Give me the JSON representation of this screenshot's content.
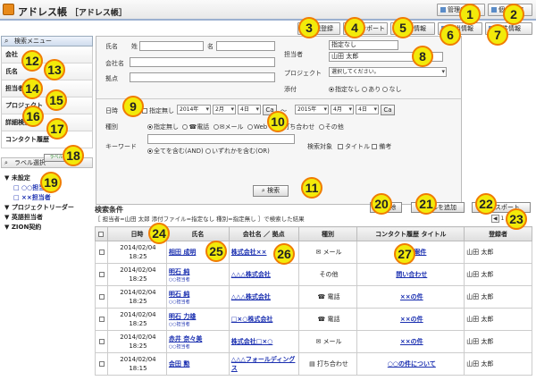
{
  "app": {
    "title": "アドレス帳",
    "subtitle": "［アドレス帳］"
  },
  "toolbar": {
    "manager_settings": "管理者設定",
    "personal_settings": "個人設定",
    "register": "新規登録",
    "import": "インポート",
    "company_info": "会社情報",
    "group_info": "担当情報",
    "project_info": "案件情報"
  },
  "sidebar": {
    "header": "検索メニュー",
    "items": [
      "会社",
      "氏名",
      "担当者",
      "プロジェクト",
      "詳細検索",
      "コンタクト履歴"
    ],
    "label_select": "ラベル選択",
    "label_btn": "ラベル",
    "tree": [
      {
        "label": "▼ 未設定",
        "indent": 0
      },
      {
        "label": "□ ○○担当者",
        "indent": 1
      },
      {
        "label": "□ ××担当者",
        "indent": 1
      },
      {
        "label": "▼ プロジェクトリーダー",
        "indent": 0
      },
      {
        "label": "▼ 英語担当者",
        "indent": 0
      },
      {
        "label": "▼ ZION契約",
        "indent": 0
      }
    ]
  },
  "form": {
    "name_label": "氏名",
    "sei_label": "姓",
    "mei_label": "名",
    "company_label": "会社名",
    "base_label": "拠点",
    "tantou_label": "担当者",
    "tantou_value1": "指定なし",
    "tantou_value2": "山田 太郎",
    "project_label": "プロジェクト",
    "project_value": "選択してください。",
    "attach_label": "添付",
    "attach_opts": [
      "指定なし",
      "あり",
      "なし"
    ],
    "date_label": "日時",
    "date_nospec": "指定無し",
    "from_year": "2014年",
    "from_month": "2月",
    "from_day": "4日",
    "cal": "Ca",
    "to_year": "2015年",
    "to_month": "4月",
    "to_day": "4日",
    "tilde": "～",
    "type_label": "種別",
    "type_opts": [
      "指定無し",
      "電話",
      "メール",
      "Web",
      "打ち合わせ",
      "その他"
    ],
    "keyword_label": "キーワード",
    "kw_opts": [
      "全てを含む(AND)",
      "いずれかを含む(OR)"
    ],
    "target_label": "検索対象",
    "target_opts": [
      "タイトル",
      "備考"
    ],
    "search_btn": "検索"
  },
  "results": {
    "heading": "検索条件",
    "condition": "［ 担当者=山田 太郎 添付ファイル=指定なし 種別=指定無し ］で検索した結果",
    "delete_btn": "削除",
    "add_label_btn": "ラベルを追加",
    "export_btn": "エクスポート",
    "pager": "1 / 2",
    "columns": [
      "",
      "日時",
      "氏名",
      "会社名 ／ 拠点",
      "種別",
      "コンタクト履歴 タイトル",
      "登録者"
    ],
    "rows": [
      {
        "date": "2014/02/04",
        "time": "18:25",
        "name": "相田 成明",
        "sub": "",
        "company": "株式会社××",
        "type": "メール",
        "title": "○○の案件",
        "user": "山田 太郎"
      },
      {
        "date": "2014/02/04",
        "time": "18:25",
        "name": "明石 純",
        "sub": "○○担当者",
        "company": "△△△株式会社",
        "type": "その他",
        "title": "問い合わせ",
        "user": "山田 太郎"
      },
      {
        "date": "2014/02/04",
        "time": "18:25",
        "name": "明石 純",
        "sub": "○○担当者",
        "company": "△△△株式会社",
        "type": "電話",
        "title": "××の件",
        "user": "山田 太郎"
      },
      {
        "date": "2014/02/04",
        "time": "18:25",
        "name": "明石 力雄",
        "sub": "○○担当者",
        "company": "□×○株式会社",
        "type": "電話",
        "title": "××の件",
        "user": "山田 太郎"
      },
      {
        "date": "2014/02/04",
        "time": "18:25",
        "name": "赤井 奈々美",
        "sub": "○○担当者",
        "company": "株式会社□×○",
        "type": "メール",
        "title": "××の件",
        "user": "山田 太郎"
      },
      {
        "date": "2014/02/04",
        "time": "18:15",
        "name": "会田 勲",
        "sub": "",
        "company": "△△△フォールディングス",
        "type": "打ち合わせ",
        "title": "○○の件について",
        "user": "山田 太郎"
      }
    ]
  },
  "markers": [
    "1",
    "2",
    "3",
    "4",
    "5",
    "6",
    "7",
    "8",
    "9",
    "10",
    "11",
    "12",
    "13",
    "14",
    "15",
    "16",
    "17",
    "18",
    "19",
    "20",
    "21",
    "22",
    "23",
    "24",
    "25",
    "26",
    "27"
  ]
}
